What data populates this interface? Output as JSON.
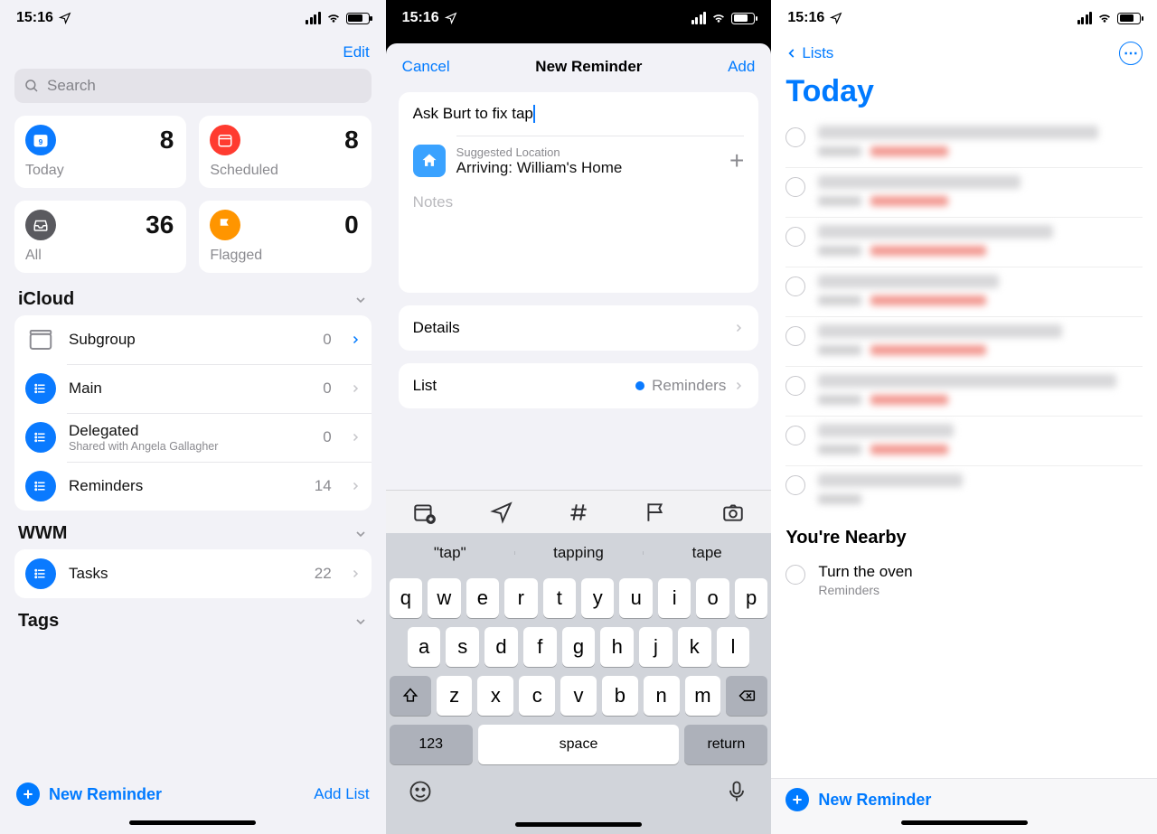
{
  "status": {
    "time": "15:16"
  },
  "p1": {
    "edit": "Edit",
    "search_placeholder": "Search",
    "cards": {
      "today": {
        "label": "Today",
        "count": "8"
      },
      "scheduled": {
        "label": "Scheduled",
        "count": "8"
      },
      "all": {
        "label": "All",
        "count": "36"
      },
      "flagged": {
        "label": "Flagged",
        "count": "0"
      }
    },
    "sections": {
      "icloud": "iCloud",
      "wwm": "WWM",
      "tags": "Tags"
    },
    "lists": {
      "subgroup": {
        "name": "Subgroup",
        "count": "0"
      },
      "main": {
        "name": "Main",
        "count": "0"
      },
      "delegated": {
        "name": "Delegated",
        "sub": "Shared with Angela Gallagher",
        "count": "0"
      },
      "reminders": {
        "name": "Reminders",
        "count": "14"
      },
      "tasks": {
        "name": "Tasks",
        "count": "22"
      }
    },
    "new_reminder": "New Reminder",
    "add_list": "Add List"
  },
  "p2": {
    "cancel": "Cancel",
    "title": "New Reminder",
    "add": "Add",
    "input_value": "Ask Burt to fix tap",
    "sugg_label": "Suggested Location",
    "sugg_value": "Arriving: William's Home",
    "notes_placeholder": "Notes",
    "details": "Details",
    "list": "List",
    "list_value": "Reminders",
    "suggestions": {
      "s1": "\"tap\"",
      "s2": "tapping",
      "s3": "tape"
    },
    "keys": {
      "row1": [
        "q",
        "w",
        "e",
        "r",
        "t",
        "y",
        "u",
        "i",
        "o",
        "p"
      ],
      "row2": [
        "a",
        "s",
        "d",
        "f",
        "g",
        "h",
        "j",
        "k",
        "l"
      ],
      "row3": [
        "z",
        "x",
        "c",
        "v",
        "b",
        "n",
        "m"
      ],
      "k123": "123",
      "space": "space",
      "return": "return"
    }
  },
  "p3": {
    "back": "Lists",
    "title": "Today",
    "nearby": "You're Nearby",
    "nearby_item": {
      "title": "Turn the oven",
      "sub": "Reminders"
    },
    "new_reminder": "New Reminder",
    "items_widths": [
      {
        "t": 310,
        "g": 48,
        "r": 86
      },
      {
        "t": 224,
        "g": 48,
        "r": 86
      },
      {
        "t": 260,
        "g": 48,
        "r": 128
      },
      {
        "t": 200,
        "g": 48,
        "r": 128
      },
      {
        "t": 270,
        "g": 48,
        "r": 128
      },
      {
        "t": 330,
        "g": 48,
        "r": 86
      },
      {
        "t": 150,
        "g": 48,
        "r": 86
      },
      {
        "t": 160,
        "g": 48,
        "r": 0
      }
    ]
  }
}
